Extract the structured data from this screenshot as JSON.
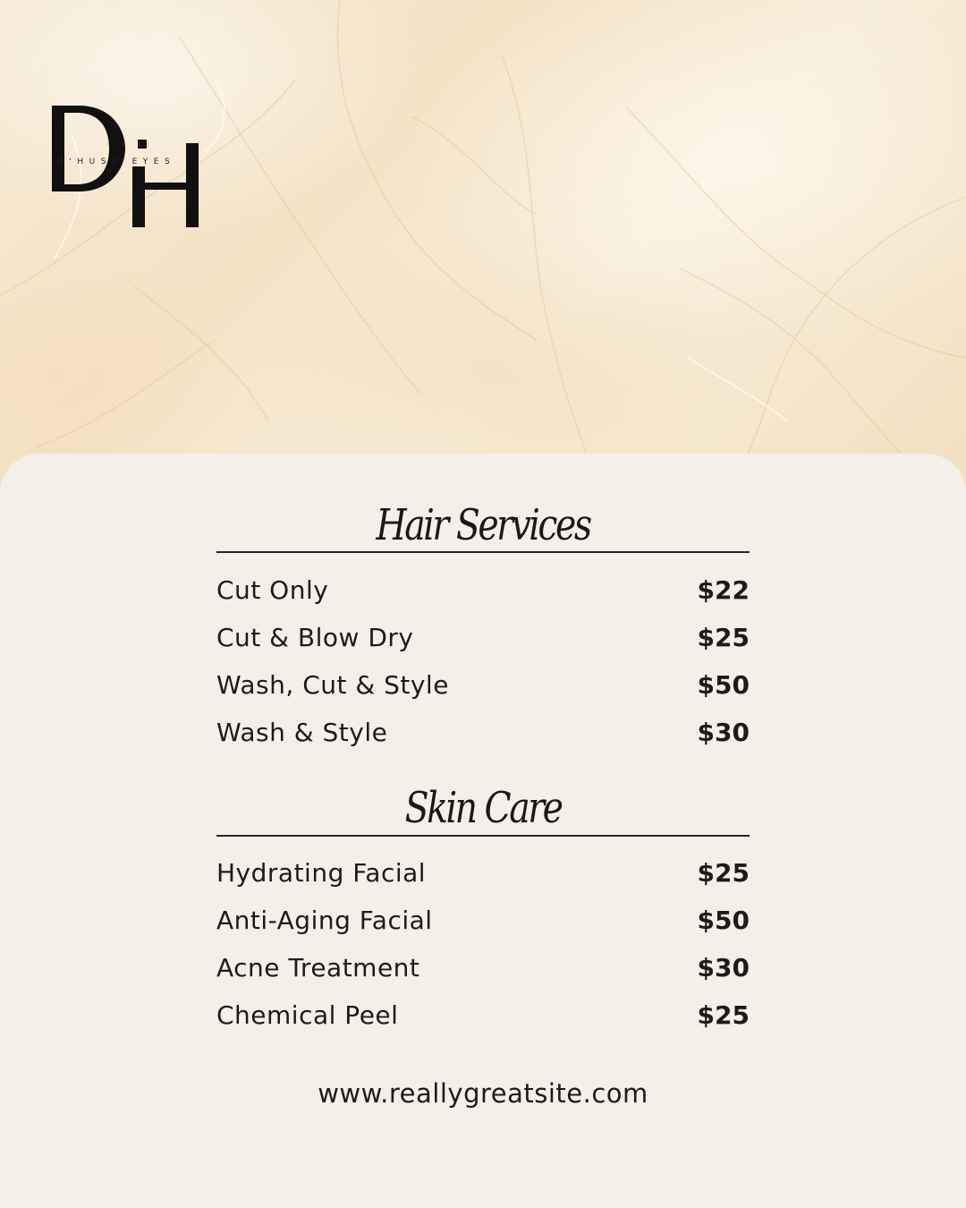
{
  "brand": {
    "monogram_left": "D",
    "monogram_right": "H",
    "name": "D'HUSH EYES"
  },
  "sections": [
    {
      "title": "Hair Services",
      "items": [
        {
          "name": "Cut Only",
          "price": "$22"
        },
        {
          "name": "Cut & Blow Dry",
          "price": "$25"
        },
        {
          "name": "Wash, Cut & Style",
          "price": "$50"
        },
        {
          "name": "Wash & Style",
          "price": "$30"
        }
      ]
    },
    {
      "title": "Skin Care",
      "items": [
        {
          "name": "Hydrating Facial",
          "price": "$25"
        },
        {
          "name": "Anti-Aging Facial",
          "price": "$50"
        },
        {
          "name": "Acne Treatment",
          "price": "$30"
        },
        {
          "name": "Chemical Peel",
          "price": "$25"
        }
      ]
    }
  ],
  "footer": {
    "website": "www.reallygreatsite.com"
  },
  "colors": {
    "text": "#1f1a17",
    "panel": "#f3f0e9",
    "marble": "#f4e2c5"
  }
}
